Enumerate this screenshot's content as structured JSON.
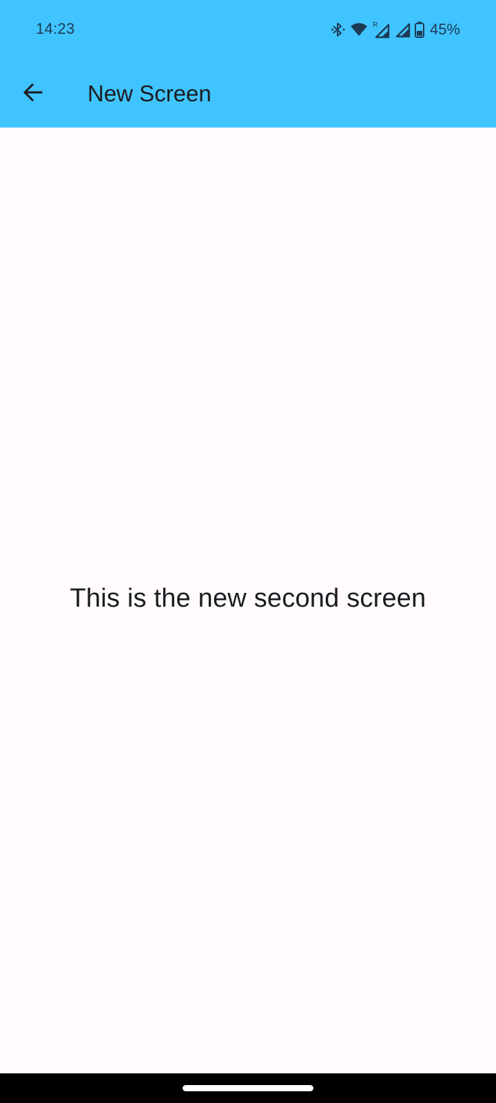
{
  "status_bar": {
    "time": "14:23",
    "battery_percent": "45%",
    "battery_level": 0.45,
    "icons": [
      "bluetooth-icon",
      "wifi-icon",
      "signal-roaming-icon",
      "signal-icon",
      "battery-icon"
    ],
    "roaming_label": "R"
  },
  "app_bar": {
    "title": "New Screen",
    "back_icon": "arrow-back-icon",
    "background_color": "#40c4ff"
  },
  "main": {
    "message": "This is the new second screen",
    "background_color": "#fffbfe"
  },
  "nav_bar": {
    "handle": "home-gesture-handle"
  }
}
